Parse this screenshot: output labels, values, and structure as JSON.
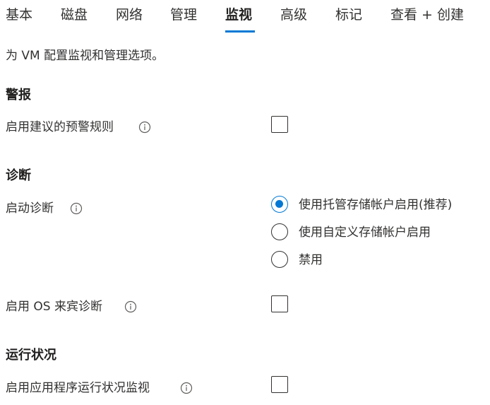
{
  "tabs": [
    {
      "label": "基本"
    },
    {
      "label": "磁盘"
    },
    {
      "label": "网络"
    },
    {
      "label": "管理"
    },
    {
      "label": "监视",
      "active": true
    },
    {
      "label": "高级"
    },
    {
      "label": "标记"
    },
    {
      "label": "查看 + 创建"
    }
  ],
  "subtitle": "为 VM 配置监视和管理选项。",
  "alerts": {
    "title": "警报",
    "enable_rules_label": "启用建议的预警规则",
    "enable_rules_checked": false
  },
  "diagnostics": {
    "title": "诊断",
    "boot_label": "启动诊断",
    "boot_options": [
      {
        "label": "使用托管存储帐户启用(推荐)",
        "selected": true
      },
      {
        "label": "使用自定义存储帐户启用",
        "selected": false
      },
      {
        "label": "禁用",
        "selected": false
      }
    ],
    "guest_os_label": "启用 OS 来宾诊断",
    "guest_os_checked": false
  },
  "health": {
    "title": "运行状况",
    "app_health_label": "启用应用程序运行状况监视",
    "app_health_checked": false
  },
  "colors": {
    "accent": "#0078d4",
    "text": "#323130"
  }
}
